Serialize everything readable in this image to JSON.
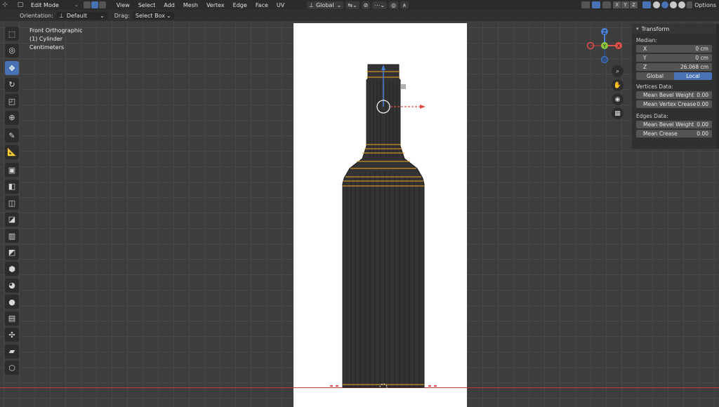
{
  "header": {
    "mode": "Edit Mode",
    "menu": [
      "View",
      "Select",
      "Add",
      "Mesh",
      "Vertex",
      "Edge",
      "Face",
      "UV"
    ],
    "transform_space": "Global",
    "axes": [
      "X",
      "Y",
      "Z"
    ],
    "options_label": "Options"
  },
  "toolheader": {
    "orientation_label": "Orientation:",
    "orientation_value": "Default",
    "drag_label": "Drag:",
    "drag_value": "Select Box"
  },
  "viewport": {
    "view_name": "Front Orthographic",
    "object_name": "(1) Cylinder",
    "units": "Centimeters"
  },
  "gizmo": {
    "x": "X",
    "y": "Y",
    "z": "Z"
  },
  "npanel": {
    "title": "Transform",
    "median_label": "Median:",
    "fields": [
      {
        "label": "X",
        "value": "0 cm"
      },
      {
        "label": "Y",
        "value": "0 cm"
      },
      {
        "label": "Z",
        "value": "26.068 cm"
      }
    ],
    "space_toggle": [
      "Global",
      "Local"
    ],
    "vertices_label": "Vertices Data:",
    "vertex_fields": [
      {
        "label": "Mean Bevel Weight",
        "value": "0.00"
      },
      {
        "label": "Mean Vertex Crease",
        "value": "0.00"
      }
    ],
    "edges_label": "Edges Data:",
    "edge_fields": [
      {
        "label": "Mean Bevel Weight",
        "value": "0.00"
      },
      {
        "label": "Mean Crease",
        "value": "0.00"
      }
    ]
  },
  "colors": {
    "accent": "#4772b3",
    "x_axis": "#c23b3b",
    "selection": "#f5a623"
  }
}
